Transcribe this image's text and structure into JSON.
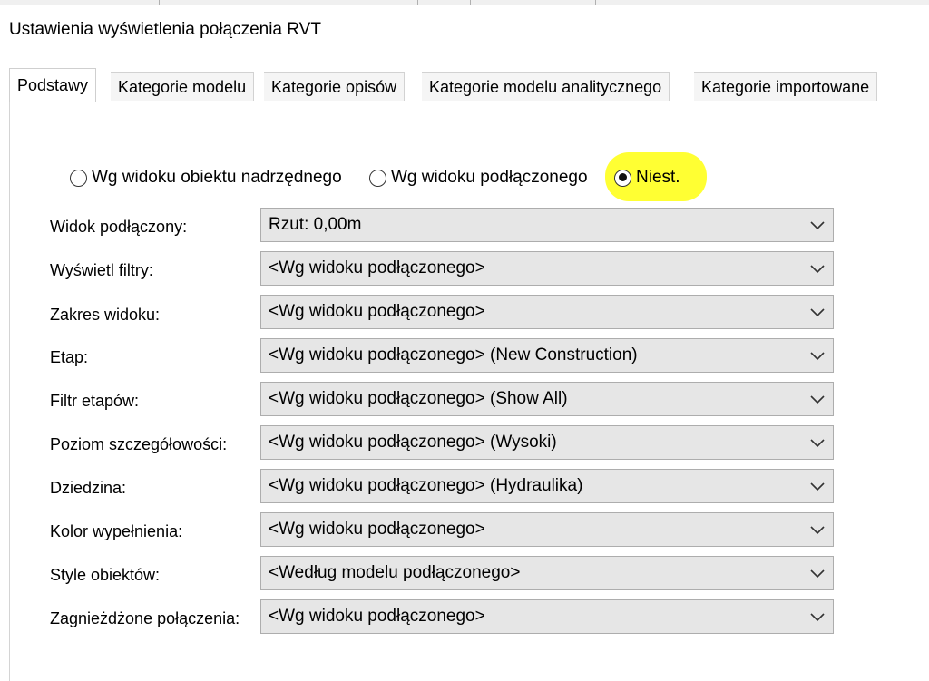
{
  "window": {
    "title": "Ustawienia wyświetlenia połączenia RVT"
  },
  "tabs": [
    {
      "label": "Podstawy",
      "active": true
    },
    {
      "label": "Kategorie modelu",
      "active": false
    },
    {
      "label": "Kategorie opisów",
      "active": false
    },
    {
      "label": "Kategorie modelu analitycznego",
      "active": false
    },
    {
      "label": "Kategorie importowane",
      "active": false
    }
  ],
  "display_mode": {
    "options": [
      {
        "label": "Wg widoku obiektu nadrzędnego",
        "selected": false
      },
      {
        "label": "Wg widoku podłączonego",
        "selected": false
      },
      {
        "label": "Niest.",
        "selected": true
      }
    ],
    "highlight_color": "#ffff33"
  },
  "fields": [
    {
      "label": "Widok podłączony:",
      "value": "Rzut: 0,00m"
    },
    {
      "label": "Wyświetl filtry:",
      "value": "<Wg widoku podłączonego>"
    },
    {
      "label": "Zakres widoku:",
      "value": "<Wg widoku podłączonego>"
    },
    {
      "label": "Etap:",
      "value": "<Wg widoku podłączonego> (New Construction)"
    },
    {
      "label": "Filtr etapów:",
      "value": "<Wg widoku podłączonego> (Show All)"
    },
    {
      "label": "Poziom szczegółowości:",
      "value": "<Wg widoku podłączonego> (Wysoki)"
    },
    {
      "label": "Dziedzina:",
      "value": "<Wg widoku podłączonego> (Hydraulika)"
    },
    {
      "label": "Kolor wypełnienia:",
      "value": "<Wg widoku podłączonego>"
    },
    {
      "label": "Style obiektów:",
      "value": "<Według modelu podłączonego>"
    },
    {
      "label": "Zagnieżdżone połączenia:",
      "value": "<Wg widoku podłączonego>"
    }
  ],
  "icons": {
    "dropdown": "chevron-down-icon",
    "radio": "radio-button-icon"
  }
}
